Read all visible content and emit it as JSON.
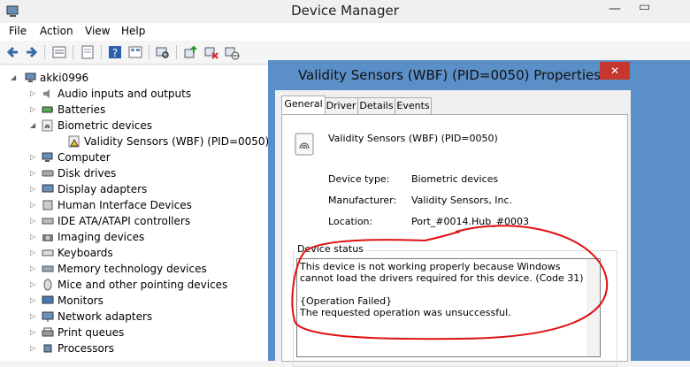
{
  "window": {
    "title": "Device Manager"
  },
  "menu": [
    {
      "label": "File"
    },
    {
      "label": "Action"
    },
    {
      "label": "View"
    },
    {
      "label": "Help"
    }
  ],
  "toolbar_icons": [
    "back-arrow-icon",
    "forward-arrow-icon",
    "properties-sheet-icon",
    "show-hidden-icon",
    "help-icon",
    "device-grid-icon",
    "scan-hardware-icon",
    "update-driver-icon",
    "uninstall-device-icon",
    "disable-device-icon"
  ],
  "tree": {
    "root": "akki0996",
    "items": [
      {
        "label": "Audio inputs and outputs",
        "icon": "speaker-icon",
        "expanded": false
      },
      {
        "label": "Batteries",
        "icon": "battery-icon",
        "expanded": false
      },
      {
        "label": "Biometric devices",
        "icon": "fingerprint-icon",
        "expanded": true
      },
      {
        "label": "Validity Sensors (WBF) (PID=0050)",
        "icon": "warning-device-icon",
        "child": true
      },
      {
        "label": "Computer",
        "icon": "computer-icon",
        "expanded": false
      },
      {
        "label": "Disk drives",
        "icon": "disk-icon",
        "expanded": false
      },
      {
        "label": "Display adapters",
        "icon": "display-icon",
        "expanded": false
      },
      {
        "label": "Human Interface Devices",
        "icon": "hid-icon",
        "expanded": false
      },
      {
        "label": "IDE ATA/ATAPI controllers",
        "icon": "ide-icon",
        "expanded": false
      },
      {
        "label": "Imaging devices",
        "icon": "camera-icon",
        "expanded": false
      },
      {
        "label": "Keyboards",
        "icon": "keyboard-icon",
        "expanded": false
      },
      {
        "label": "Memory technology devices",
        "icon": "memory-icon",
        "expanded": false
      },
      {
        "label": "Mice and other pointing devices",
        "icon": "mouse-icon",
        "expanded": false
      },
      {
        "label": "Monitors",
        "icon": "monitor-icon",
        "expanded": false
      },
      {
        "label": "Network adapters",
        "icon": "network-icon",
        "expanded": false
      },
      {
        "label": "Print queues",
        "icon": "printer-icon",
        "expanded": false
      },
      {
        "label": "Processors",
        "icon": "processor-icon",
        "expanded": false
      }
    ]
  },
  "dialog": {
    "title": "Validity Sensors (WBF) (PID=0050) Properties",
    "close": "✕",
    "tabs": [
      {
        "label": "General",
        "active": true
      },
      {
        "label": "Driver"
      },
      {
        "label": "Details"
      },
      {
        "label": "Events"
      }
    ],
    "device_name": "Validity Sensors (WBF) (PID=0050)",
    "fields": [
      {
        "label": "Device type:",
        "value": "Biometric devices"
      },
      {
        "label": "Manufacturer:",
        "value": "Validity Sensors, Inc."
      },
      {
        "label": "Location:",
        "value": "Port_#0014.Hub_#0003"
      }
    ],
    "status_title": "Device status",
    "status_text": "This device is not working properly because Windows cannot load the drivers required for this device. (Code 31)\n\n{Operation Failed}\nThe requested operation was unsuccessful."
  },
  "colors": {
    "dialog_border": "#5b8fc7",
    "close_button": "#c7372d",
    "annotation_red": "#e01010"
  }
}
